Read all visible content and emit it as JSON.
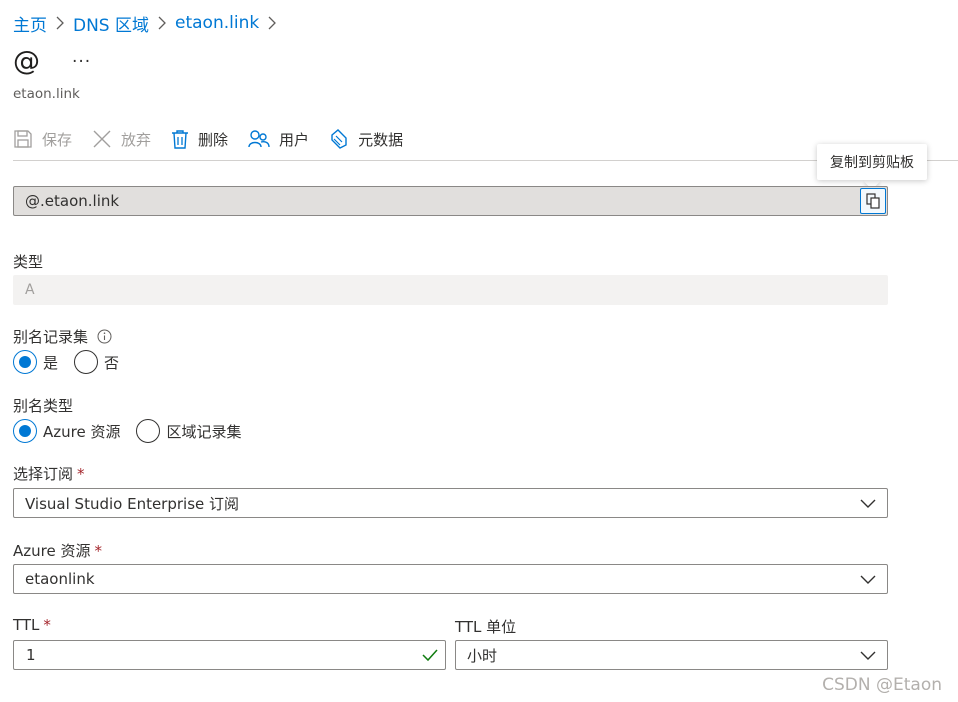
{
  "breadcrumb": {
    "items": [
      "主页",
      "DNS 区域",
      "etaon.link"
    ]
  },
  "header": {
    "title": "@",
    "more": "···",
    "subtitle": "etaon.link"
  },
  "toolbar": {
    "save": "保存",
    "discard": "放弃",
    "delete": "删除",
    "users": "用户",
    "metadata": "元数据"
  },
  "tooltip": "复制到剪贴板",
  "fqdn": "@.etaon.link",
  "type": {
    "label": "类型",
    "value": "A"
  },
  "alias_record_set": {
    "label": "别名记录集",
    "options": [
      "是",
      "否"
    ],
    "selected": "是"
  },
  "alias_type": {
    "label": "别名类型",
    "options": [
      "Azure 资源",
      "区域记录集"
    ],
    "selected": "Azure 资源"
  },
  "subscription": {
    "label": "选择订阅",
    "required": "*",
    "value": "Visual Studio Enterprise 订阅"
  },
  "azure_resource": {
    "label": "Azure 资源",
    "required": "*",
    "value": "etaonlink"
  },
  "ttl": {
    "label": "TTL",
    "required": "*",
    "value": "1"
  },
  "ttl_unit": {
    "label": "TTL 单位",
    "value": "小时"
  },
  "watermark": "CSDN @Etaon",
  "colors": {
    "accent": "#0078d4",
    "required": "#a4262c",
    "success": "#107c10"
  }
}
